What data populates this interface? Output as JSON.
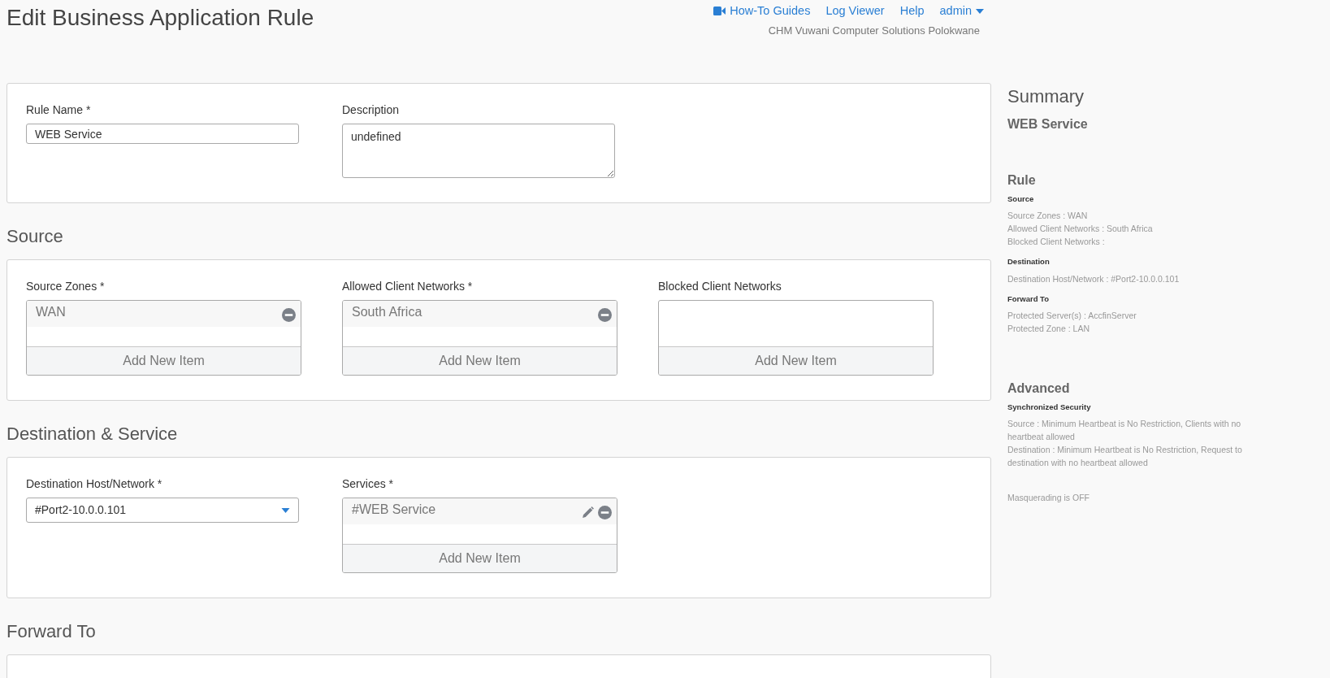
{
  "page_title": "Edit Business Application Rule",
  "header": {
    "links": [
      {
        "label": "How-To Guides",
        "kind": "video"
      },
      {
        "label": "Log Viewer",
        "kind": "plain"
      },
      {
        "label": "Help",
        "kind": "plain"
      },
      {
        "label": "admin",
        "kind": "menu"
      }
    ],
    "organization": "CHM Vuwani Computer Solutions Polokwane"
  },
  "sections": [
    {
      "fields": [
        {
          "kind": "text",
          "label": "Rule Name *",
          "value": "WEB Service"
        },
        {
          "kind": "textarea",
          "label": "Description",
          "value": "undefined"
        }
      ]
    },
    {
      "heading": "Source",
      "fields": [
        {
          "kind": "list",
          "label": "Source Zones *",
          "items": [
            {
              "text": "WAN",
              "editable": false
            }
          ],
          "add_label": "Add New Item"
        },
        {
          "kind": "list",
          "label": "Allowed Client Networks *",
          "items": [
            {
              "text": "South Africa",
              "editable": false
            }
          ],
          "add_label": "Add New Item"
        },
        {
          "kind": "list",
          "label": "Blocked Client Networks",
          "add_label": "Add New Item"
        }
      ]
    },
    {
      "heading": "Destination & Service",
      "fields": [
        {
          "kind": "select",
          "label": "Destination Host/Network *",
          "value": "#Port2-10.0.0.101"
        },
        {
          "kind": "list",
          "label": "Services *",
          "items": [
            {
              "text": "#WEB Service",
              "editable": true
            }
          ],
          "add_label": "Add New Item"
        }
      ]
    },
    {
      "heading": "Forward To"
    }
  ],
  "summary": {
    "title": "Summary",
    "rule_name": "WEB Service",
    "groups": [
      {
        "heading": "Rule",
        "subgroups": [
          {
            "title": "Source",
            "lines": [
              "Source Zones : WAN",
              "Allowed Client Networks : South Africa",
              "Blocked Client Networks :"
            ]
          },
          {
            "title": "Destination",
            "lines": [
              "Destination Host/Network : #Port2-10.0.0.101"
            ]
          },
          {
            "title": "Forward To",
            "lines": [
              "Protected Server(s) : AccfinServer",
              "Protected Zone : LAN"
            ]
          }
        ]
      },
      {
        "heading": "Advanced",
        "subgroups": [
          {
            "title": "Synchronized Security",
            "lines": [
              "Source : Minimum Heartbeat is No Restriction, Clients with no heartbeat allowed",
              "Destination : Minimum Heartbeat is No Restriction, Request to destination with no heartbeat allowed"
            ]
          }
        ]
      }
    ],
    "footer_note": "Masquerading is OFF"
  }
}
